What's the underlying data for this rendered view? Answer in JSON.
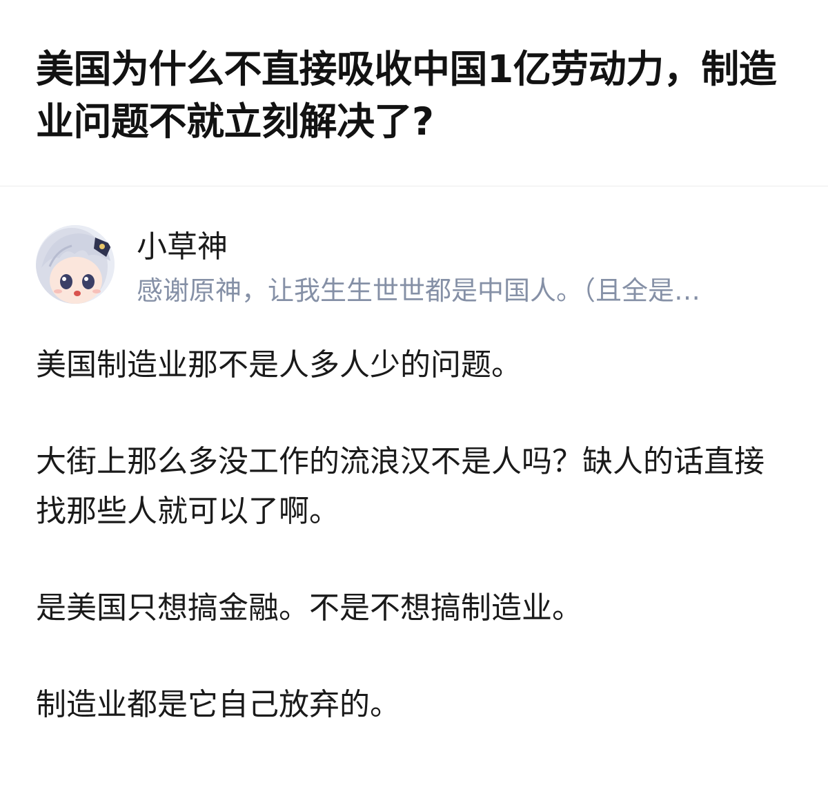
{
  "question": {
    "title": "美国为什么不直接吸收中国1亿劳动力，制造业问题不就立刻解决了?"
  },
  "answer": {
    "author": {
      "avatar_icon": "anime-avatar-icon",
      "name": "小草神",
      "bio": "感谢原神，让我生生世世都是中国人。（且全是…"
    },
    "paragraphs": [
      "美国制造业那不是人多人少的问题。",
      "大街上那么多没工作的流浪汉不是人吗？缺人的话直接找那些人就可以了啊。",
      "是美国只想搞金融。不是不想搞制造业。",
      "制造业都是它自己放弃的。"
    ]
  },
  "colors": {
    "title": "#121212",
    "text": "#1a1a1a",
    "bio": "#8590a6",
    "divider": "#ebebeb"
  }
}
